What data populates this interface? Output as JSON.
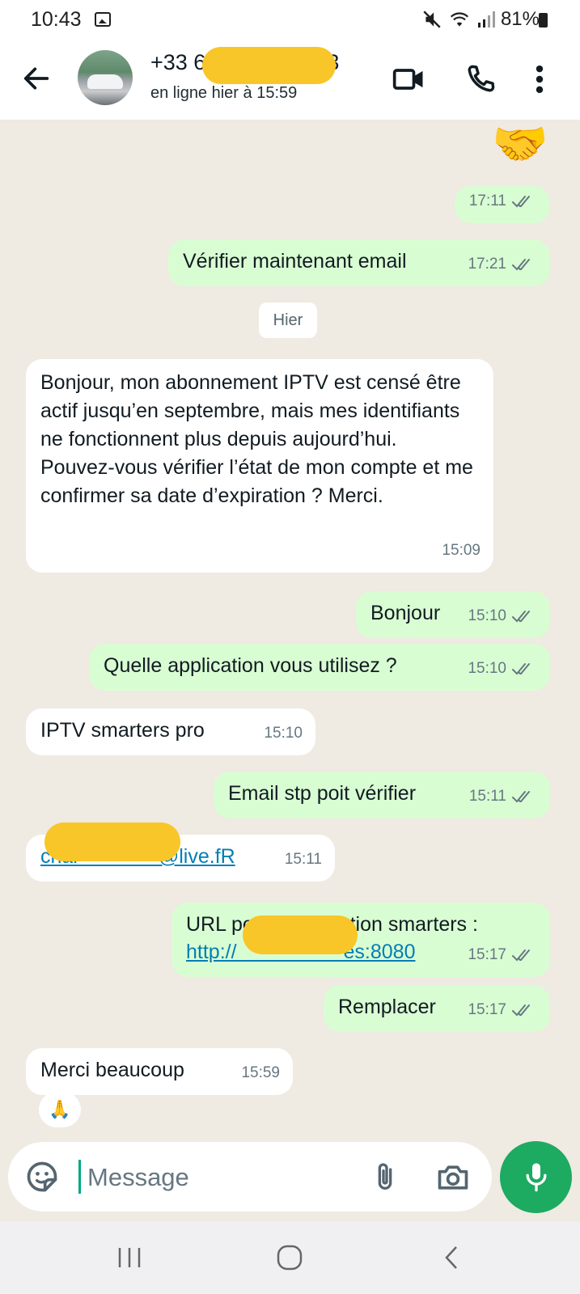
{
  "status_bar": {
    "time": "10:43",
    "battery": "81%",
    "icons": [
      "gallery-icon",
      "mute-icon",
      "wifi-icon",
      "signal-icon",
      "battery-icon"
    ]
  },
  "header": {
    "contact_name": "+33 6                  43",
    "last_seen": "en ligne hier à 15:59",
    "icons": [
      "back-arrow-icon",
      "video-call-icon",
      "phone-icon",
      "more-vert-icon"
    ]
  },
  "messages": [
    {
      "direction": "out",
      "text": "",
      "time": "17:11"
    },
    {
      "direction": "out",
      "text": "Vérifier maintenant email",
      "time": "17:21"
    },
    {
      "direction": "date",
      "text": "Hier"
    },
    {
      "direction": "in",
      "text": "Bonjour, mon abonnement IPTV est censé être actif jusqu’en septembre, mais mes identifiants ne fonctionnent plus depuis aujourd’hui. Pouvez-vous vérifier l’état de mon compte et me confirmer sa date d’expiration ? Merci.",
      "time": "15:09"
    },
    {
      "direction": "out",
      "text": "Bonjour",
      "time": "15:10"
    },
    {
      "direction": "out",
      "text": "Quelle application vous utilisez ?",
      "time": "15:10"
    },
    {
      "direction": "in",
      "text": "IPTV smarters pro",
      "time": "15:10"
    },
    {
      "direction": "out",
      "text": "Email stp poit vérifier",
      "time": "15:11"
    },
    {
      "direction": "in",
      "text": "char              @live.fR",
      "time": "15:11"
    },
    {
      "direction": "out",
      "text": "URL pour l'application smarters :",
      "link": "http://                   es:8080",
      "time": "15:17"
    },
    {
      "direction": "out",
      "text": "Remplacer",
      "time": "15:17"
    },
    {
      "direction": "in",
      "text": "Merci beaucoup",
      "time": "15:59",
      "reaction": "🙏"
    }
  ],
  "sticker": "🤝",
  "composer": {
    "placeholder": "Message",
    "icons": [
      "sticker-icon",
      "attach-icon",
      "camera-icon",
      "mic-icon"
    ]
  },
  "nav_bar": {
    "icons": [
      "recents-icon",
      "home-icon",
      "back-icon"
    ]
  },
  "colors": {
    "outgoing_bubble": "#d9fdd3",
    "incoming_bubble": "#ffffff",
    "chat_background": "#efeae2",
    "accent_green": "#1daa61",
    "link_blue": "#027eb5",
    "redaction_yellow": "#f8c628"
  }
}
